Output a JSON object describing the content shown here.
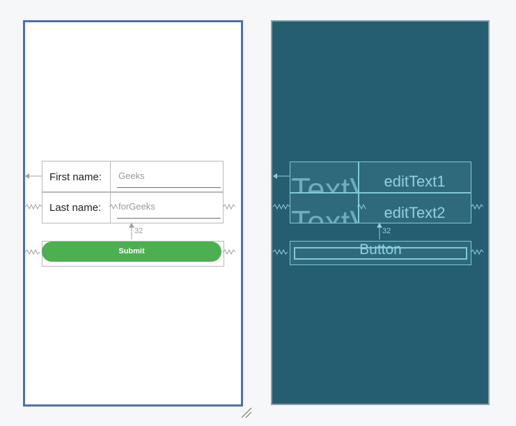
{
  "design": {
    "first_name_label": "First name:",
    "first_name_value": "Geeks",
    "last_name_label": "Last name:",
    "last_name_value": "forGeeks",
    "submit_label": "Submit",
    "margin_label": "32",
    "accent_color": "#4caf50"
  },
  "blueprint": {
    "textview_ghost": "TextView",
    "edit_text_1": "editText1",
    "edit_text_2": "editText2",
    "button_label": "Button",
    "margin_label": "32",
    "background_color": "#245e70"
  }
}
